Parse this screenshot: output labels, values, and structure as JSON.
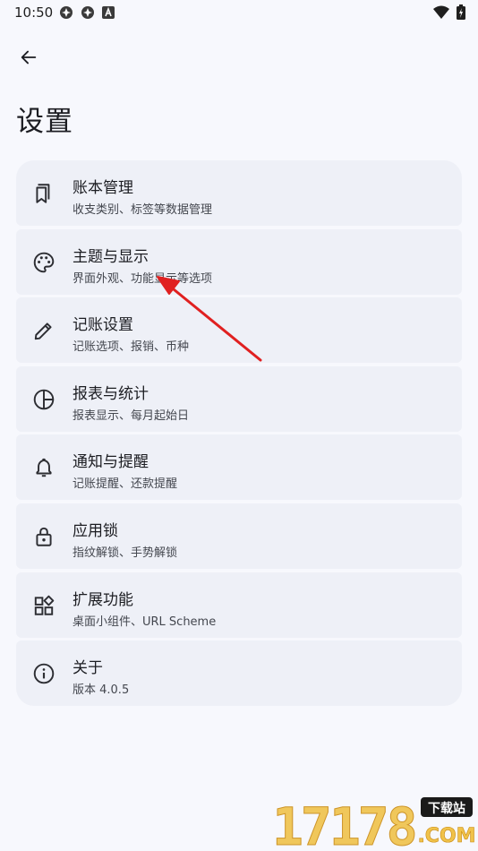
{
  "status_bar": {
    "time": "10:50"
  },
  "page": {
    "title": "设置"
  },
  "settings": [
    {
      "title": "账本管理",
      "subtitle": "收支类别、标签等数据管理",
      "icon": "book-icon"
    },
    {
      "title": "主题与显示",
      "subtitle": "界面外观、功能显示等选项",
      "icon": "palette-icon"
    },
    {
      "title": "记账设置",
      "subtitle": "记账选项、报销、币种",
      "icon": "pencil-icon"
    },
    {
      "title": "报表与统计",
      "subtitle": "报表显示、每月起始日",
      "icon": "pie-chart-icon"
    },
    {
      "title": "通知与提醒",
      "subtitle": "记账提醒、还款提醒",
      "icon": "bell-icon"
    },
    {
      "title": "应用锁",
      "subtitle": "指纹解锁、手势解锁",
      "icon": "lock-icon"
    },
    {
      "title": "扩展功能",
      "subtitle": "桌面小组件、URL Scheme",
      "icon": "widgets-icon"
    },
    {
      "title": "关于",
      "subtitle": "版本 4.0.5",
      "icon": "info-icon"
    }
  ],
  "watermark": {
    "number": "17178",
    "site": "下载站",
    "domain": ".COM"
  },
  "colors": {
    "background": "#f7f8fd",
    "card": "#eef0f7",
    "annotation_arrow": "#e02020"
  }
}
